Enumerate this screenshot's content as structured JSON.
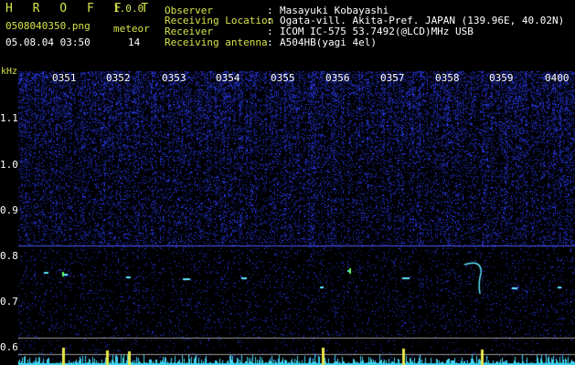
{
  "header": {
    "app_title": "H R O F F T",
    "app_version": "1.0.0",
    "file_name": "0508040350.png",
    "meteor_label": "meteor",
    "date_time": "05.08.04 03:50",
    "meteor_count": "14"
  },
  "info": [
    {
      "label": "Observer",
      "sep": ":",
      "value": "Masayuki Kobayashi"
    },
    {
      "label": "Receiving Location",
      "sep": ":",
      "value": "Ogata-vill. Akita-Pref. JAPAN (139.96E, 40.02N)"
    },
    {
      "label": "Receiver",
      "sep": ":",
      "value": "ICOM IC-575 53.7492(@LCD)MHz USB"
    },
    {
      "label": "Receiving antenna",
      "sep": ":",
      "value": "A504HB(yagi 4el)"
    }
  ],
  "axis": {
    "y_unit": "kHz",
    "y_ticks": [
      "1.1",
      "1.0",
      "0.9",
      "0.8",
      "0.7",
      "0.6"
    ],
    "x_ticks": [
      "0351",
      "0352",
      "0353",
      "0354",
      "0355",
      "0356",
      "0357",
      "0358",
      "0359",
      "0400"
    ]
  },
  "colors": {
    "background": "#000000",
    "label_yellow": "#d8e44c",
    "noise_blue": "#2c3cff",
    "trace_cyan": "#5fe8ff",
    "hline_blue": "#4a5aff",
    "hline_gray": "#9a9a9a"
  }
}
